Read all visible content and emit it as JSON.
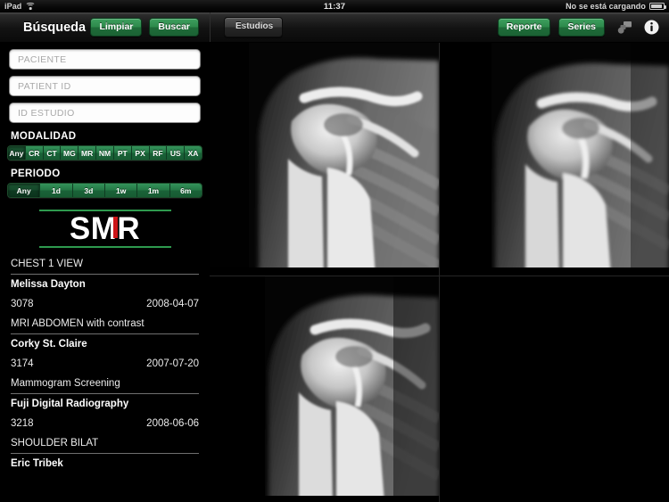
{
  "status_bar": {
    "device": "iPad",
    "wifi_icon": "wifi-icon",
    "time": "11:37",
    "charging_text": "No se está cargando",
    "battery_icon": "battery-icon"
  },
  "toolbar": {
    "panel_title": "Búsqueda",
    "clear_label": "Limpiar",
    "search_label": "Buscar",
    "back_label": "Estudios",
    "report_label": "Reporte",
    "series_label": "Series",
    "layout_icon": "layout-icon",
    "info_icon": "info-icon"
  },
  "sidebar": {
    "fields": [
      {
        "name": "patient-name",
        "placeholder": "PACIENTE",
        "value": ""
      },
      {
        "name": "patient-id",
        "placeholder": "PATIENT ID",
        "value": ""
      },
      {
        "name": "study-id",
        "placeholder": "ID ESTUDIO",
        "value": ""
      }
    ],
    "modality": {
      "label": "MODALIDAD",
      "selected": "Any",
      "options": [
        "Any",
        "CR",
        "CT",
        "MG",
        "MR",
        "NM",
        "PT",
        "PX",
        "RF",
        "US",
        "XA"
      ]
    },
    "period": {
      "label": "PERIODO",
      "selected": "Any",
      "options": [
        "Any",
        "1d",
        "3d",
        "1w",
        "1m",
        "6m"
      ]
    },
    "logo": {
      "text": "SMR",
      "rule_color": "#2e9a4e",
      "accent_color": "#cc1417"
    },
    "studies": [
      {
        "description": "CHEST 1 VIEW",
        "patient": "Melissa Dayton",
        "study_id": "3078",
        "date": "2008-04-07",
        "next_description": "MRI ABDOMEN with contrast"
      },
      {
        "patient": "Corky St. Claire",
        "study_id": "3174",
        "date": "2007-07-20",
        "next_description": "Mammogram Screening"
      },
      {
        "patient": "Fuji Digital Radiography",
        "study_id": "3218",
        "date": "2008-06-06",
        "next_description": "SHOULDER BILAT"
      },
      {
        "patient": "Eric Tribek"
      }
    ]
  },
  "viewport": {
    "layout": "2x2",
    "panes": [
      {
        "name": "image-pane-1",
        "content": "shoulder-xray",
        "empty": false
      },
      {
        "name": "image-pane-2",
        "content": "shoulder-xray",
        "empty": false
      },
      {
        "name": "image-pane-3",
        "content": "shoulder-xray",
        "empty": false
      },
      {
        "name": "image-pane-4",
        "content": "",
        "empty": true
      }
    ]
  }
}
